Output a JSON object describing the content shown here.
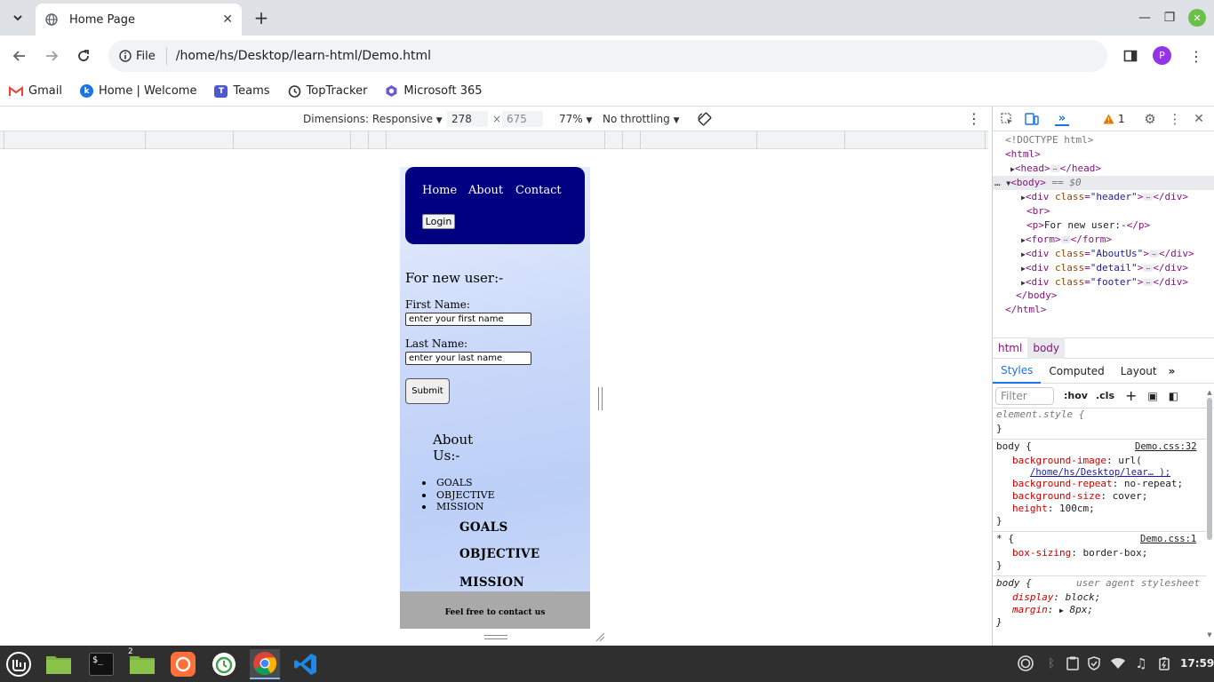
{
  "browser": {
    "tab_title": "Home Page",
    "address_chip": "File",
    "url": "/home/hs/Desktop/learn-html/Demo.html",
    "profile_initial": "P",
    "bookmarks": [
      {
        "label": "Gmail",
        "icon": "gmail-icon"
      },
      {
        "label": "Home | Welcome",
        "icon": "kodekloud-icon"
      },
      {
        "label": "Teams",
        "icon": "teams-icon"
      },
      {
        "label": "TopTracker",
        "icon": "toptracker-icon"
      },
      {
        "label": "Microsoft 365",
        "icon": "microsoft365-icon"
      }
    ]
  },
  "device_toolbar": {
    "dimensions_label": "Dimensions: Responsive",
    "width": "278",
    "height": "675",
    "times": "×",
    "zoom": "77%",
    "throttling": "No throttling"
  },
  "page": {
    "nav": [
      "Home",
      "About",
      "Contact"
    ],
    "login_label": "Login",
    "new_user_text": "For new user:-",
    "first_name_label": "First Name:",
    "first_name_placeholder": "enter your first name",
    "last_name_label": "Last Name:",
    "last_name_placeholder": "enter your last name",
    "submit_label": "Submit",
    "about_heading_line1": "About",
    "about_heading_line2": "Us:-",
    "about_list": [
      "GOALS",
      "OBJECTIVE",
      "MISSION"
    ],
    "detail_headings": [
      "GOALS",
      "OBJECTIVE",
      "MISSION"
    ],
    "footer_text": "Feel free to contact us"
  },
  "devtools": {
    "warning_count": "1",
    "dom": {
      "doctype": "<!DOCTYPE html>",
      "html_open": "<html>",
      "head": "<head>",
      "head_close": "</head>",
      "body_open": "<body>",
      "body_marker": "== $0",
      "div_header_class": "\"header\"",
      "br": "<br>",
      "p_text": "For new user:-",
      "form_open": "<form>",
      "form_close": "</form>",
      "div_about_class": "\"AboutUs\"",
      "div_detail_class": "\"detail\"",
      "div_footer_class": "\"footer\"",
      "body_close": "</body>",
      "html_close": "</html>"
    },
    "crumbs": [
      "html",
      "body"
    ],
    "panel_tabs": [
      "Styles",
      "Computed",
      "Layout"
    ],
    "filter_placeholder": "Filter",
    "hov": ":hov",
    "cls": ".cls",
    "styles": {
      "element_style": "element.style {",
      "close": "}",
      "rule1_selector": "body {",
      "rule1_source": "Demo.css:32",
      "bg_image_prop": "background-image",
      "bg_image_val": "url(",
      "bg_image_link": "/home/hs/Desktop/lear… );",
      "bg_repeat_prop": "background-repeat",
      "bg_repeat_val": "no-repeat;",
      "bg_size_prop": "background-size",
      "bg_size_val": "cover;",
      "height_prop": "height",
      "height_val": "100cm;",
      "rule2_selector": "* {",
      "rule2_source": "Demo.css:1",
      "box_sizing_prop": "box-sizing",
      "box_sizing_val": "border-box;",
      "rule3_selector": "body {",
      "rule3_source": "user agent stylesheet",
      "display_prop": "display",
      "display_val": "block;",
      "margin_prop": "margin",
      "margin_val": "8px;"
    }
  },
  "taskbar": {
    "clock": "17:59",
    "files_badge": "2"
  },
  "colors": {
    "header_bg": "#000080",
    "footer_bg": "#a9a9a9",
    "taskbar_bg": "#2f2f2f",
    "profile": "#9334e6"
  }
}
